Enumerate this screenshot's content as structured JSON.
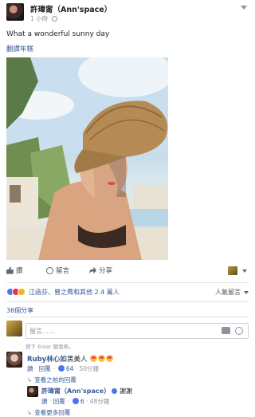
{
  "post": {
    "author": "許瑋甯（Ann'space）",
    "time": "1 小時",
    "text": "What a wonderful sunny day",
    "translate_label": "翻譯年糕"
  },
  "actions": {
    "like": "讚",
    "comment": "留言",
    "share": "分享"
  },
  "reactions": {
    "summary": "江函芬、曾之喬和其他 2.4 萬人",
    "sort_label": "人氣留言"
  },
  "shares_count": "36個分享",
  "composer": {
    "placeholder": "留言……",
    "hint": "按下 Enter 鍵發佈。"
  },
  "comments": [
    {
      "author": "Ruby林心如",
      "text": "黑美人",
      "like_label": "讚",
      "reply_label": "回覆",
      "like_count": "64",
      "time": "50分鐘",
      "previous_replies": "查看之前的回覆",
      "reply": {
        "author": "許瑋甯（Ann'space）",
        "text": "謝謝",
        "like_label": "讚",
        "reply_label": "回覆",
        "like_count": "6",
        "time": "48分鐘"
      },
      "more_replies": "查看更多回覆"
    }
  ],
  "colors": {
    "link": "#365899",
    "meta": "#90949c",
    "text": "#1d2129"
  }
}
